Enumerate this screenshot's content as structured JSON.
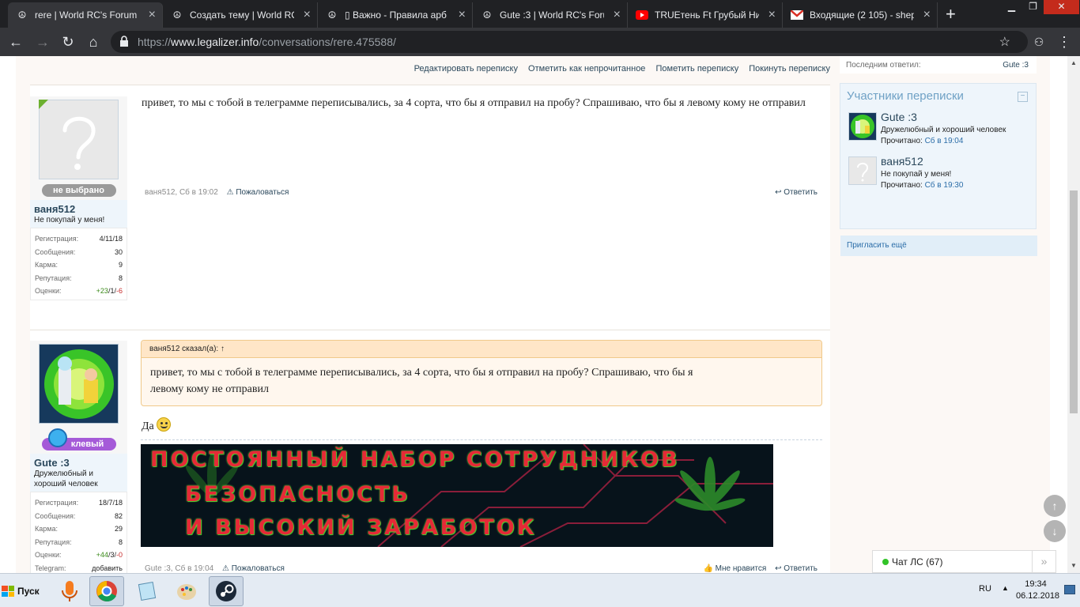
{
  "browser": {
    "tabs": [
      {
        "title": "rere | World RC's Forum |",
        "icon": "peace-icon",
        "active": true
      },
      {
        "title": "Создать тему | World RC",
        "icon": "peace-icon",
        "active": false
      },
      {
        "title": "▯ Важно - Правила арб",
        "icon": "peace-icon",
        "active": false
      },
      {
        "title": "Gute :3 | World RC's Foru",
        "icon": "peace-icon",
        "active": false
      },
      {
        "title": "TRUEтень Ft Грубый Ни",
        "icon": "youtube-icon",
        "active": false
      },
      {
        "title": "Входящие (2 105) - shep",
        "icon": "gmail-icon",
        "active": false
      }
    ],
    "url_scheme": "https://",
    "url_host": "www.legalizer.info",
    "url_path": "/conversations/rere.475588/"
  },
  "conversation_actions": [
    "Редактировать переписку",
    "Отметить как непрочитанное",
    "Пометить переписку",
    "Покинуть переписку"
  ],
  "messages": [
    {
      "author": "ваня512",
      "rank": "не выбрано",
      "user_title": "Не покупай у меня!",
      "stats": [
        {
          "label": "Регистрация:",
          "value": "4/11/18"
        },
        {
          "label": "Сообщения:",
          "value": "30"
        },
        {
          "label": "Карма:",
          "value": "9"
        },
        {
          "label": "Репутация:",
          "value": "8"
        }
      ],
      "ratings_label": "Оценки:",
      "ratings": {
        "pos": "+23",
        "neu": "1",
        "neg": "-6"
      },
      "text": "привет, то мы с тобой в телеграмме переписывались, за 4 сорта, что бы я отправил на пробу? Спрашиваю, что бы я левому кому не отправил",
      "meta": "ваня512, Сб в 19:02",
      "report": "Пожаловаться",
      "reply": "Ответить"
    },
    {
      "author": "Gute :3",
      "rank": "клевый",
      "user_title_1": "Дружелюбный и",
      "user_title_2": "хороший человек",
      "stats": [
        {
          "label": "Регистрация:",
          "value": "18/7/18"
        },
        {
          "label": "Сообщения:",
          "value": "82"
        },
        {
          "label": "Карма:",
          "value": "29"
        },
        {
          "label": "Репутация:",
          "value": "8"
        }
      ],
      "ratings_label": "Оценки:",
      "ratings": {
        "pos": "+44",
        "neu": "3",
        "neg": "-0"
      },
      "telegram_label": "Telegram:",
      "telegram_value": "добавить",
      "quote_head": "ваня512 сказал(а): ↑",
      "quote_text_1": "привет, то мы с тобой в телеграмме переписывались, за 4 сорта, что бы я отправил на пробу? Спрашиваю, что бы я",
      "quote_text_2": "левому кому не отправил",
      "text": "Да",
      "banner_lines": [
        "ПОСТОЯННЫЙ НАБОР СОТРУДНИКОВ",
        "БЕЗОПАСНОСТЬ",
        "И ВЫСОКИЙ ЗАРАБОТОК"
      ],
      "meta": "Gute :3, Сб в 19:04",
      "report": "Пожаловаться",
      "like": "Мне нравится",
      "reply": "Ответить"
    }
  ],
  "sidebar": {
    "last_reply_label": "Последним ответил:",
    "last_reply_user": "Gute :3",
    "participants_title": "Участники переписки",
    "participants": [
      {
        "name": "Gute :3",
        "title": "Дружелюбный и хороший человек",
        "read_label": "Прочитано:",
        "read_time": "Сб в 19:04"
      },
      {
        "name": "ваня512",
        "title": "Не покупай у меня!",
        "read_label": "Прочитано:",
        "read_time": "Сб в 19:30"
      }
    ],
    "invite": "Пригласить ещё"
  },
  "chat": {
    "label": "Чат ЛС (67)"
  },
  "taskbar": {
    "start": "Пуск",
    "lang": "RU",
    "time": "19:34",
    "date": "06.12.2018"
  },
  "colors": {
    "accent": "#2b485c",
    "rank_none": "#9a9a9a",
    "rank_cool": "#a55ad8",
    "online": "#32c328"
  }
}
